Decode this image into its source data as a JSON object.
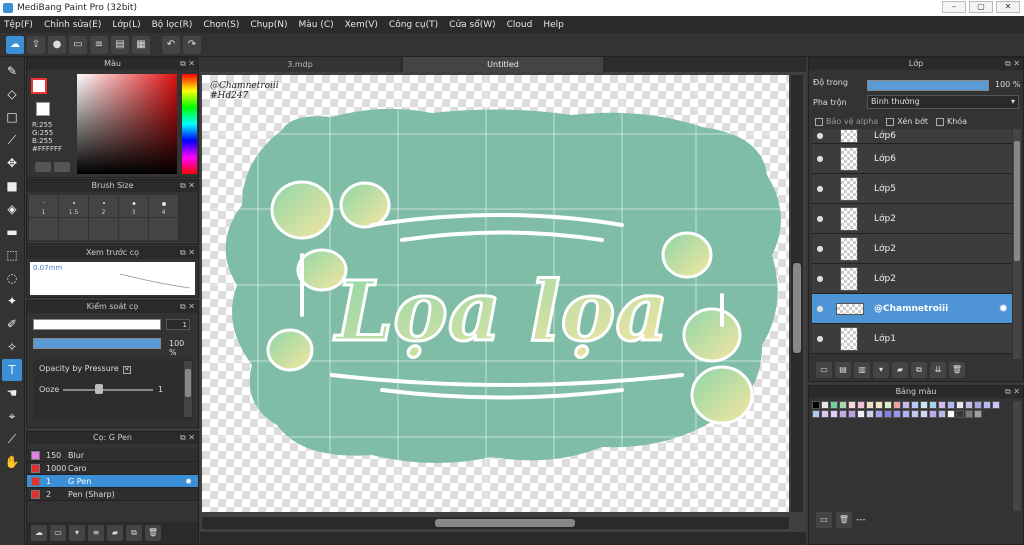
{
  "app": {
    "title": "MediBang Paint Pro (32bit)"
  },
  "menu": [
    "Tệp(F)",
    "Chỉnh sửa(E)",
    "Lớp(L)",
    "Bộ lọc(R)",
    "Chọn(S)",
    "Chụp(N)",
    "Màu (C)",
    "Xem(V)",
    "Công cụ(T)",
    "Cửa sổ(W)",
    "Cloud",
    "Help"
  ],
  "panels": {
    "color": {
      "title": "Màu",
      "rgb": "R:255\nG:255\nB:255\n#FFFFFF",
      "primary": "#e02020",
      "secondary": "#ffffff"
    },
    "brush_size": {
      "title": "Brush Size",
      "sizes": [
        "1",
        "1.5",
        "2",
        "3",
        "4"
      ]
    },
    "preview": {
      "title": "Xem trước cọ",
      "size": "0.07mm"
    },
    "control": {
      "title": "Kiểm soát cọ",
      "size_value": "1",
      "opacity_value": "100 %",
      "pressure_label": "Opacity by Pressure",
      "pressure_checked": "✕",
      "ooze_label": "Ooze",
      "ooze_value": "1"
    },
    "brush_list": {
      "title": "Cọ: G Pen",
      "items": [
        {
          "size": "150",
          "name": "Blur",
          "color": "#e080e0"
        },
        {
          "size": "1000",
          "name": "Caro",
          "color": "#e03030"
        },
        {
          "size": "1",
          "name": "G Pen",
          "color": "#e03030",
          "selected": true
        },
        {
          "size": "2",
          "name": "Pen (Sharp)",
          "color": "#e03030"
        }
      ]
    },
    "layer": {
      "title": "Lớp",
      "opacity_label": "Độ trong",
      "opacity_value": "100 %",
      "blend_label": "Pha trộn",
      "blend_value": "Bình thường",
      "protect_alpha": "Bảo vệ alpha",
      "clipping": "Xén bớt",
      "lock": "Khóa",
      "layers": [
        {
          "name": "Lớp6",
          "selected": false
        },
        {
          "name": "Lớp6",
          "selected": false
        },
        {
          "name": "Lớp5",
          "selected": false
        },
        {
          "name": "Lớp2",
          "selected": false
        },
        {
          "name": "Lớp2",
          "selected": false
        },
        {
          "name": "Lớp2",
          "selected": false
        },
        {
          "name": "@Chamnetroiii",
          "selected": true
        },
        {
          "name": "Lớp1",
          "selected": false
        }
      ]
    },
    "palette": {
      "title": "Bảng màu",
      "status": "---"
    }
  },
  "tabs": [
    "3.mdp",
    "Untitled"
  ],
  "canvas": {
    "credit_line1": "@Chamnetroiii",
    "credit_line2": "#Hd247",
    "artwork_text": "Lọa lọa"
  },
  "colors": {
    "accent": "#3b8fd6",
    "canvas_green": "#7fbda7",
    "text_gradient_a": "#8fd6a8",
    "text_gradient_b": "#f4e6a0"
  }
}
